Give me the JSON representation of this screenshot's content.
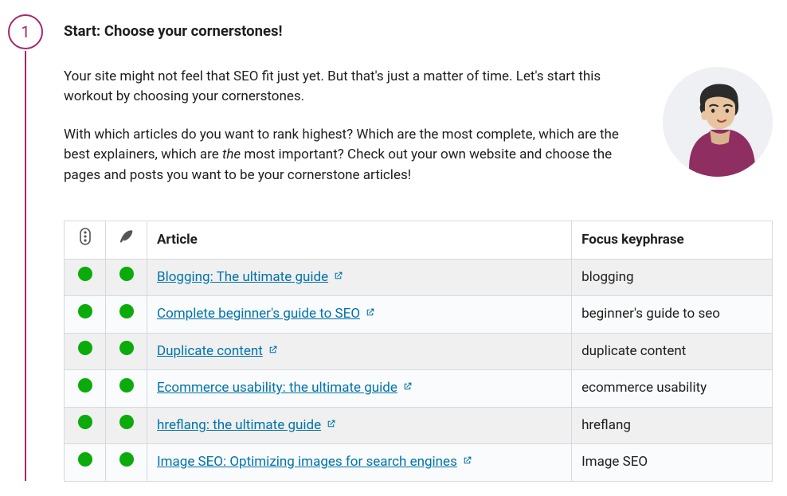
{
  "step": {
    "number": "1",
    "title": "Start: Choose your cornerstones!"
  },
  "intro": {
    "p1": "Your site might not feel that SEO fit just yet. But that's just a matter of time. Let's start this workout by choosing your cornerstones.",
    "p2_a": "With which articles do you want to rank highest? Which are the most complete, which are the best explainers, which are ",
    "p2_em": "the",
    "p2_b": " most important? Check out your own website and choose the pages and posts you want to be your cornerstone articles!"
  },
  "table": {
    "headers": {
      "article": "Article",
      "keyphrase": "Focus keyphrase"
    },
    "rows": [
      {
        "title": "Blogging: The ultimate guide",
        "keyphrase": "blogging"
      },
      {
        "title": "Complete beginner's guide to SEO",
        "keyphrase": "beginner's guide to seo"
      },
      {
        "title": "Duplicate content",
        "keyphrase": "duplicate content"
      },
      {
        "title": "Ecommerce usability: the ultimate guide",
        "keyphrase": "ecommerce usability"
      },
      {
        "title": "hreflang: the ultimate guide",
        "keyphrase": "hreflang"
      },
      {
        "title": "Image SEO: Optimizing images for search engines",
        "keyphrase": "Image SEO"
      }
    ]
  },
  "colors": {
    "accent": "#a4286a",
    "link": "#0073aa",
    "status_good": "#0aab0a"
  }
}
